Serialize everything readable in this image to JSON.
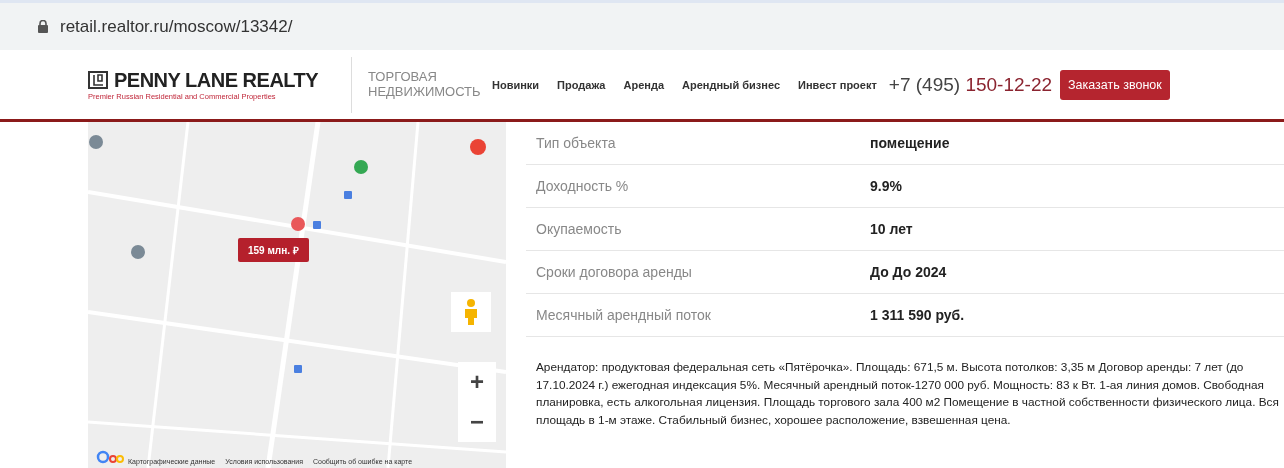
{
  "browser": {
    "url": "retail.realtor.ru/moscow/13342/"
  },
  "header": {
    "logo": {
      "name": "PENNY LANE REALTY",
      "tagline": "Premier Russian Residential and Commercial Properties"
    },
    "section_title": "ТОРГОВАЯ НЕДВИЖИМОСТЬ",
    "nav": [
      "Новинки",
      "Продажа",
      "Аренда",
      "Арендный бизнес",
      "Инвест проект"
    ],
    "phone": {
      "code": "+7 (495)",
      "number": "150-12-22"
    },
    "callback_button": "Заказать звонок"
  },
  "map": {
    "kind": "picture",
    "price_marker": "159 млн. ₽",
    "zoom_in": "+",
    "zoom_out": "−",
    "attribution": [
      "Картографические данные",
      "Условия использования",
      "Сообщить об ошибке на карте"
    ]
  },
  "details": [
    {
      "label": "Тип объекта",
      "value": "помещение"
    },
    {
      "label": "Доходность %",
      "value": "9.9%"
    },
    {
      "label": "Окупаемость",
      "value": "10 лет"
    },
    {
      "label": "Сроки договора аренды",
      "value": "До До 2024"
    },
    {
      "label": "Месячный арендный поток",
      "value": "1 311 590 руб."
    }
  ],
  "description": "Арендатор: продуктовая федеральная сеть «Пятёрочка».  Площадь: 671,5 м.  Высота потолков: 3,35 м Договор аренды: 7 лет (до 17.10.2024 г.) ежегодная индексация 5%.   Месячный арендный поток-1270 000 руб. Мощность: 83 к Вт. 1-ая линия домов. Свободная планировка, есть алкогольная лицензия.   Площадь торгового зала 400 м2 Помещение в частной собственности физического лица. Вся площадь в 1-м этаже. Стабильный бизнес, хорошее расположение, взвешенная цена."
}
